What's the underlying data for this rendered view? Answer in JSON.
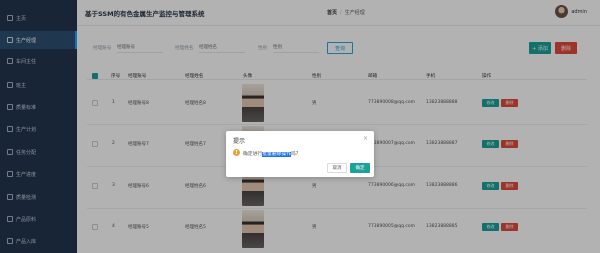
{
  "sidebar": {
    "items": [
      {
        "label": "主页",
        "icon": "home-icon"
      },
      {
        "label": "生产经理",
        "icon": "user-icon",
        "active": true
      },
      {
        "label": "车间主任",
        "icon": "user-icon"
      },
      {
        "label": "班主",
        "icon": "user-icon"
      },
      {
        "label": "质量标准",
        "icon": "file-icon"
      },
      {
        "label": "生产计划",
        "icon": "calendar-icon"
      },
      {
        "label": "任务分配",
        "icon": "tasks-icon"
      },
      {
        "label": "生产进度",
        "icon": "progress-icon"
      },
      {
        "label": "质量检测",
        "icon": "check-icon"
      },
      {
        "label": "产品原料",
        "icon": "box-icon"
      },
      {
        "label": "产品入库",
        "icon": "warehouse-icon"
      }
    ]
  },
  "header": {
    "title": "基于SSM的有色金属生产监控与管理系统",
    "breadcrumb": {
      "home": "首页",
      "separator": "/",
      "current": "生产经理"
    },
    "username": "admin"
  },
  "search": {
    "fields": [
      {
        "label": "经理账号",
        "placeholder": "经理账号"
      },
      {
        "label": "经理姓名",
        "placeholder": "经理姓名"
      },
      {
        "label": "性别",
        "placeholder": "性别"
      }
    ],
    "search_label": "查询",
    "add_label": "+ 添加",
    "delete_label": "删除"
  },
  "table": {
    "columns": [
      "序号",
      "经理账号",
      "经理姓名",
      "头像",
      "性别",
      "邮箱",
      "手机",
      "操作"
    ],
    "rows": [
      {
        "index": "1",
        "account": "经理账号8",
        "name": "经理姓名8",
        "gender": "男",
        "email": "773890008@qq.com",
        "phone": "13823888888"
      },
      {
        "index": "2",
        "account": "经理账号7",
        "name": "经理姓名7",
        "gender": "男",
        "email": "773890007@qq.com",
        "phone": "13823888887"
      },
      {
        "index": "3",
        "account": "经理账号6",
        "name": "经理姓名6",
        "gender": "男",
        "email": "773890006@qq.com",
        "phone": "13823888886"
      },
      {
        "index": "4",
        "account": "经理账号5",
        "name": "经理姓名5",
        "gender": "男",
        "email": "773890005@qq.com",
        "phone": "13823888885"
      }
    ],
    "edit_label": "修改",
    "remove_label": "删除"
  },
  "dialog": {
    "title": "提示",
    "close": "×",
    "message_prefix": "确定进行",
    "message_highlight": "批量删除操作",
    "message_suffix": "吗?",
    "cancel_label": "取消",
    "ok_label": "确定"
  },
  "colors": {
    "sidebar_bg": "#22364f",
    "accent": "#1ba39a",
    "danger": "#e14b3b",
    "info": "#2aa7e0"
  }
}
